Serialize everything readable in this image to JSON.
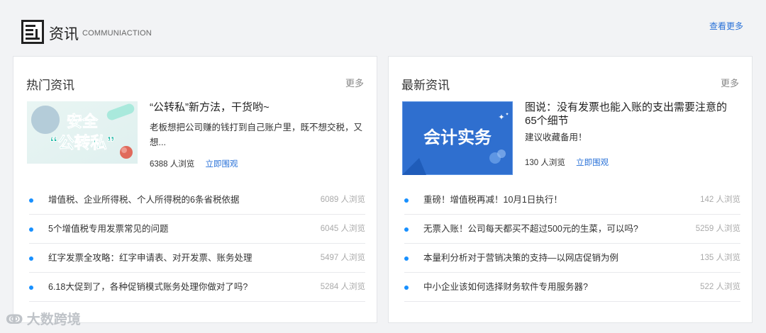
{
  "header": {
    "icon": "news-icon",
    "title": "资讯",
    "subtitle": "COMMUNIACTION",
    "more_label": "查看更多"
  },
  "hot": {
    "title": "热门资讯",
    "more_label": "更多",
    "feature": {
      "image_text_line1": "安全",
      "image_text_line2": "“公转私”",
      "title": "“公转私”新方法，干货哟~",
      "desc": "老板想把公司赚的钱打到自己账户里，既不想交税，又想...",
      "views": "6388 人浏览",
      "cta": "立即围观"
    },
    "items": [
      {
        "title": "增值税、企业所得税、个人所得税的6条省税依据",
        "views": "6089 人浏览"
      },
      {
        "title": "5个增值税专用发票常见的问题",
        "views": "6045 人浏览"
      },
      {
        "title": "红字发票全攻略：红字申请表、对开发票、账务处理",
        "views": "5497 人浏览"
      },
      {
        "title": "6.18大促到了，各种促销模式账务处理你做对了吗?",
        "views": "5284 人浏览"
      }
    ]
  },
  "latest": {
    "title": "最新资讯",
    "more_label": "更多",
    "feature": {
      "image_text": "会计实务",
      "title": "图说：没有发票也能入账的支出需要注意的65个细节",
      "desc": "建议收藏备用！",
      "views": "130 人浏览",
      "cta": "立即围观"
    },
    "items": [
      {
        "title": "重磅！增值税再减！10月1日执行！",
        "views": "142 人浏览"
      },
      {
        "title": "无票入账！公司每天都买不超过500元的生菜，可以吗?",
        "views": "5259 人浏览"
      },
      {
        "title": "本量利分析对于营销决策的支持—以网店促销为例",
        "views": "135 人浏览"
      },
      {
        "title": "中小企业该如何选择财务软件专用服务器?",
        "views": "522 人浏览"
      }
    ]
  },
  "watermark": "大数跨境",
  "colors": {
    "accent": "#2a72d8",
    "dot": "#1890ff",
    "latest_image_bg": "#2f6fcf"
  }
}
